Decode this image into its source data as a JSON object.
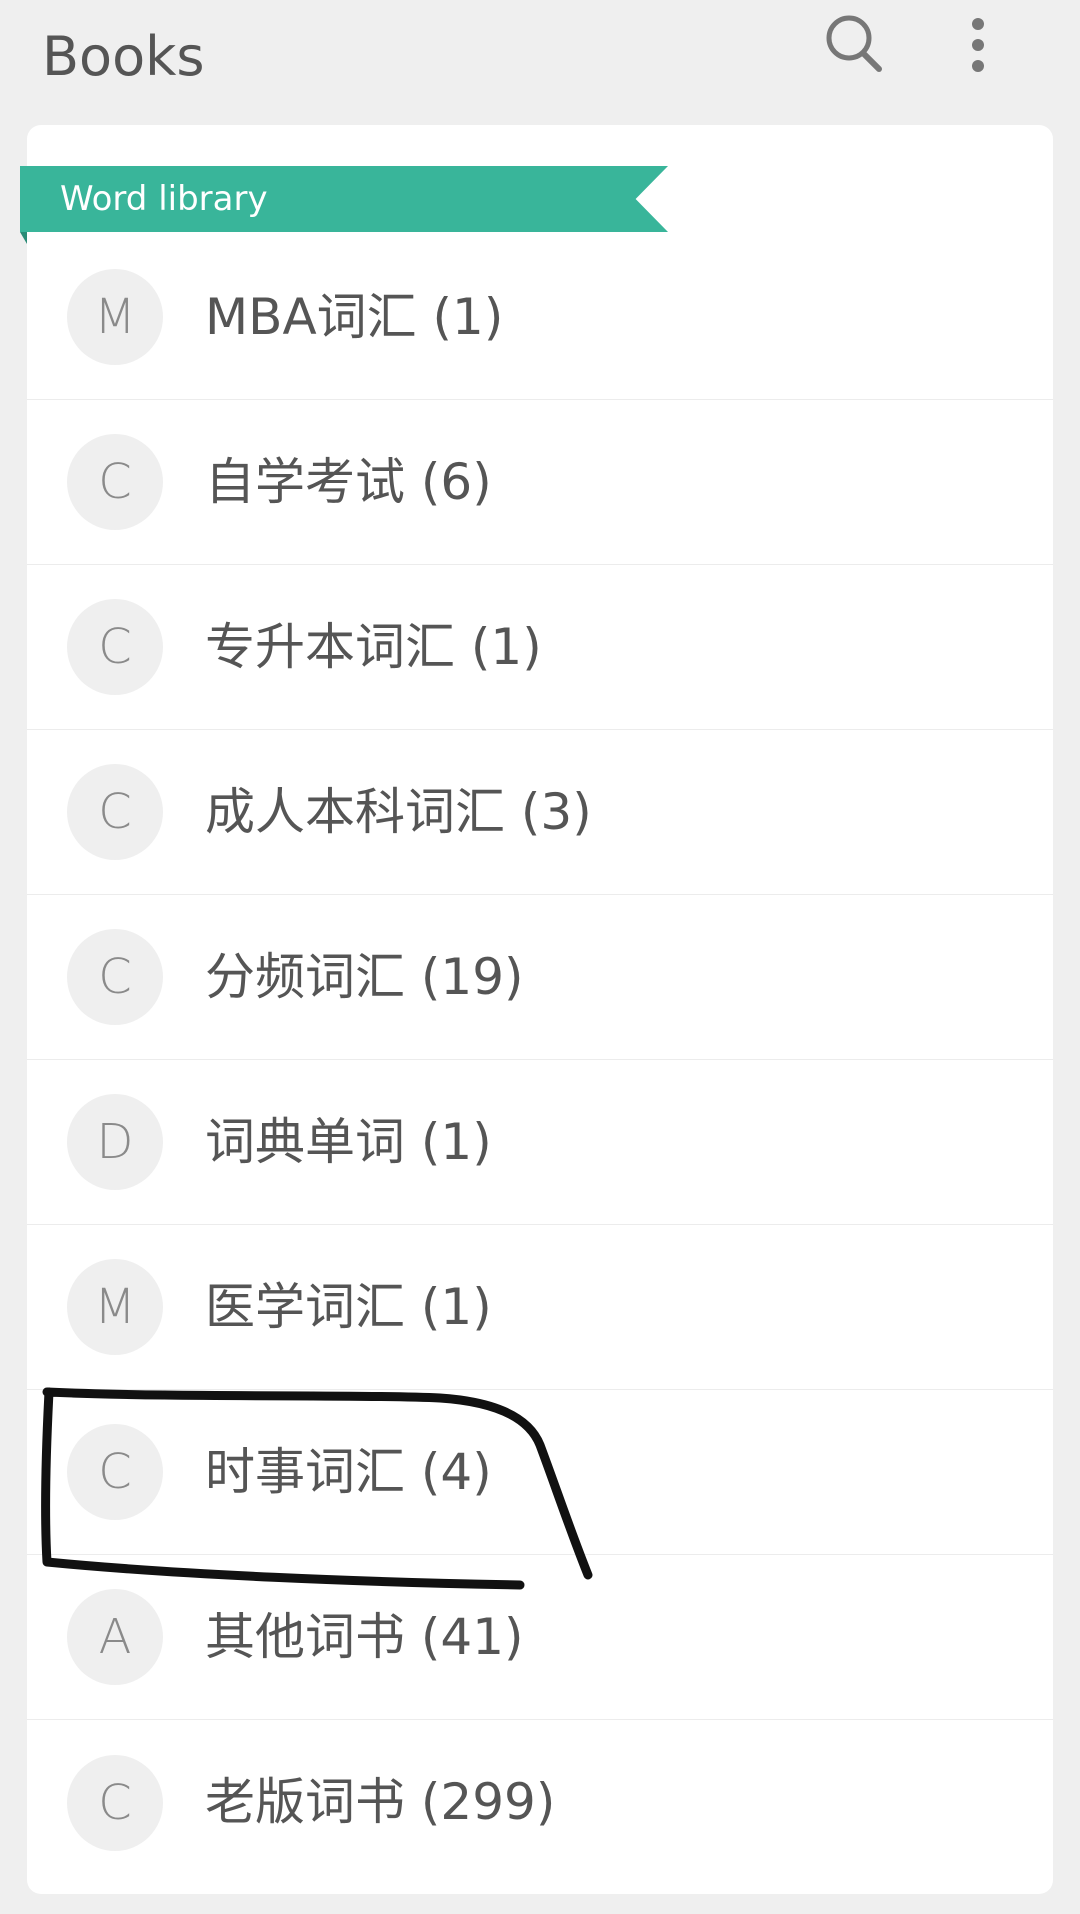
{
  "header": {
    "title": "Books",
    "search_icon": "search-icon",
    "more_icon": "more-vertical-icon"
  },
  "section": {
    "label": "Word library",
    "accent_color": "#39b59a"
  },
  "books": [
    {
      "initial": "M",
      "label": "MBA词汇 (1)"
    },
    {
      "initial": "C",
      "label": "自学考试 (6)"
    },
    {
      "initial": "C",
      "label": "专升本词汇 (1)"
    },
    {
      "initial": "C",
      "label": "成人本科词汇 (3)"
    },
    {
      "initial": "C",
      "label": "分频词汇 (19)"
    },
    {
      "initial": "D",
      "label": "词典单词 (1)"
    },
    {
      "initial": "M",
      "label": "医学词汇 (1)"
    },
    {
      "initial": "C",
      "label": "时事词汇 (4)"
    },
    {
      "initial": "A",
      "label": "其他词书 (41)"
    },
    {
      "initial": "C",
      "label": "老版词书 (299)"
    }
  ]
}
